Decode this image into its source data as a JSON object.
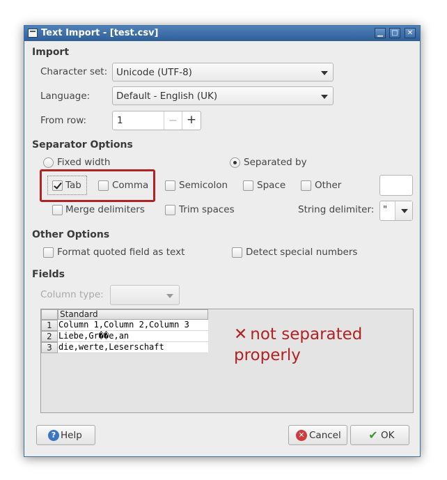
{
  "window": {
    "title": "Text Import - [test.csv]",
    "controls": {
      "minimize": "▁",
      "maximize": "□",
      "close": "✕"
    }
  },
  "import": {
    "section_title": "Import",
    "charset_label": "Character set:",
    "charset_value": "Unicode (UTF-8)",
    "language_label": "Language:",
    "language_value": "Default - English (UK)",
    "from_row_label": "From row:",
    "from_row_value": "1",
    "minus": "−",
    "plus": "+"
  },
  "separator": {
    "section_title": "Separator Options",
    "fixed_width": {
      "label": "Fixed width",
      "checked": false
    },
    "separated_by": {
      "label": "Separated by",
      "checked": true
    },
    "tab": {
      "label": "Tab",
      "checked": true
    },
    "comma": {
      "label": "Comma",
      "checked": false
    },
    "semicolon": {
      "label": "Semicolon",
      "checked": false
    },
    "space": {
      "label": "Space",
      "checked": false
    },
    "other": {
      "label": "Other",
      "checked": false,
      "value": ""
    },
    "merge": {
      "label": "Merge delimiters",
      "checked": false
    },
    "trim": {
      "label": "Trim spaces",
      "checked": false
    },
    "string_delim_label": "String delimiter:",
    "string_delim_value": "\""
  },
  "other_options": {
    "section_title": "Other Options",
    "format_quoted": {
      "label": "Format quoted field as text",
      "checked": false
    },
    "detect_special": {
      "label": "Detect special numbers",
      "checked": false
    }
  },
  "fields": {
    "section_title": "Fields",
    "column_type_label": "Column type:",
    "column_type_value": "",
    "header": "Standard",
    "rows": [
      {
        "num": "1",
        "text": "Column 1,Column 2,Column 3"
      },
      {
        "num": "2",
        "text": "Liebe,Gr��e,an"
      },
      {
        "num": "3",
        "text": "die,werte,Leserschaft"
      }
    ]
  },
  "annotation": {
    "icon": "✕",
    "line1": "not separated",
    "line2": "properly",
    "color": "#b22222"
  },
  "buttons": {
    "help": "Help",
    "cancel": "Cancel",
    "ok": "OK"
  },
  "colors": {
    "titlebar": "#3b6ea5",
    "dialog_bg": "#ededed",
    "highlight_box": "#b22222"
  }
}
